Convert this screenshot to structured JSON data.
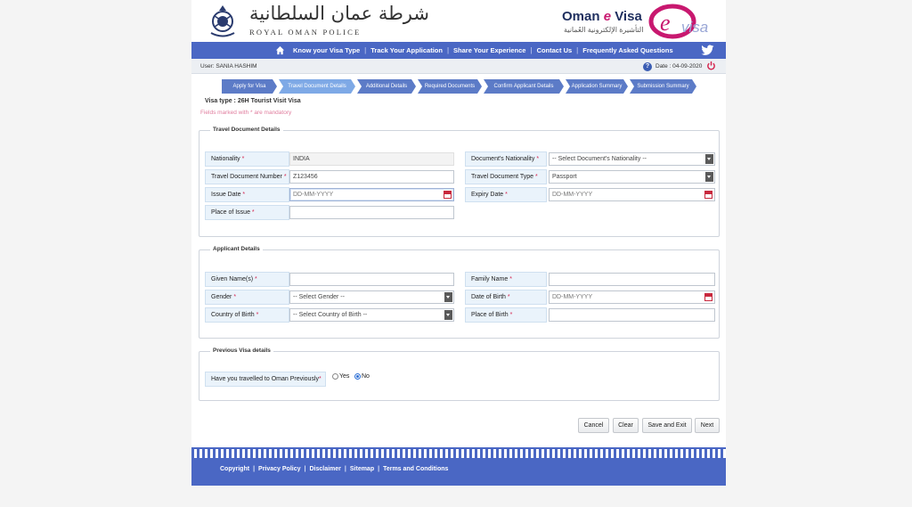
{
  "header": {
    "rop_arabic": "شرطة عمان السلطانية",
    "rop_english": "ROYAL OMAN POLICE",
    "site_title_part1": "Oman ",
    "site_title_e": "e",
    "site_title_part2": " Visa",
    "site_title_arabic": "التأشيرة الإلكترونية العُمانية",
    "logo_e": "e",
    "logo_visa": "visa"
  },
  "nav": {
    "items": [
      "Know your Visa Type",
      "Track Your Application",
      "Share Your Experience",
      "Contact Us",
      "Frequently Asked Questions"
    ],
    "separator": "|"
  },
  "userbar": {
    "user_label": "User:",
    "user_name": "SANIA HASHIM",
    "date_label": "Date :",
    "date_value": "04-09-2020"
  },
  "steps": [
    "Apply for Visa",
    "Travel Document Details",
    "Additional Details",
    "Required Documents",
    "Confirm Applicant Details",
    "Application Summary",
    "Submission Summary"
  ],
  "active_step": 1,
  "visa_type": "Visa type : 26H Tourist Visit Visa",
  "fields_note": "Fields marked with * are mandatory",
  "travel_doc": {
    "legend": "Travel Document Details",
    "nationality_label": "Nationality",
    "nationality_value": "INDIA",
    "doc_nationality_label": "Document's Nationality",
    "doc_nationality_value": "-- Select Document's Nationality --",
    "travel_doc_number_label": "Travel Document Number",
    "travel_doc_number_value": "Z123456",
    "travel_doc_type_label": "Travel Document Type",
    "travel_doc_type_value": "Passport",
    "issue_date_label": "Issue Date",
    "issue_date_placeholder": "DD-MM-YYYY",
    "expiry_date_label": "Expiry Date",
    "expiry_date_placeholder": "DD-MM-YYYY",
    "place_of_issue_label": "Place of Issue",
    "place_of_issue_value": ""
  },
  "applicant": {
    "legend": "Applicant Details",
    "given_names_label": "Given Name(s)",
    "family_name_label": "Family Name",
    "gender_label": "Gender",
    "gender_value": "-- Select Gender --",
    "dob_label": "Date of Birth",
    "dob_placeholder": "DD-MM-YYYY",
    "country_of_birth_label": "Country of Birth",
    "country_of_birth_value": "-- Select Country of Birth --",
    "place_of_birth_label": "Place of Birth"
  },
  "previous_visa": {
    "legend": "Previous Visa details",
    "question": "Have you travelled to Oman Previously",
    "yes_label": "Yes",
    "no_label": "No",
    "selected": "No"
  },
  "buttons": {
    "cancel": "Cancel",
    "clear": "Clear",
    "save_exit": "Save and Exit",
    "next": "Next"
  },
  "footer": {
    "links": [
      "Copyright",
      "Privacy Policy",
      "Disclaimer",
      "Sitemap",
      "Terms and Conditions"
    ]
  },
  "colors": {
    "nav_blue": "#4a67c4",
    "step_blue": "#5c7bc7",
    "step_active": "#7ea9e6",
    "required_red": "#d5254f",
    "brand_magenta": "#c8186f"
  }
}
